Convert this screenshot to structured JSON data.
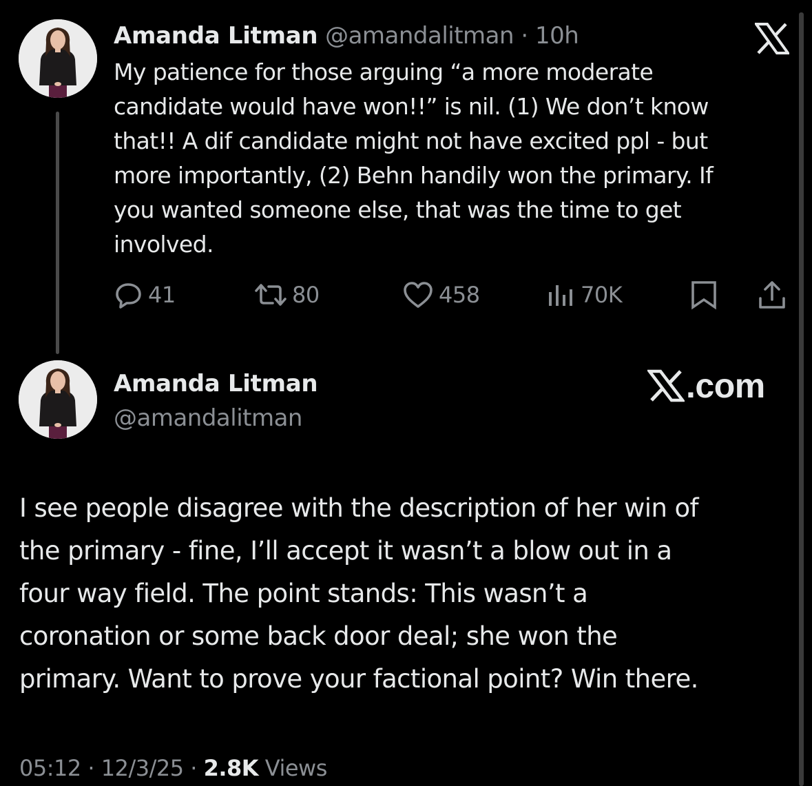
{
  "tweet": {
    "author_name": "Amanda Litman",
    "author_handle": "@amandalitman",
    "time_ago": "10h",
    "separator": " · ",
    "text": "My patience for those arguing “a more moderate\ncandidate would have won!!” is nil. (1) We don’t know\nthat!! A dif candidate might not have excited ppl - but\nmore importantly, (2) Behn handily won the primary. If\nyou wanted someone else, that was the time to get\ninvolved.",
    "actions": {
      "replies": "41",
      "reposts": "80",
      "likes": "458",
      "views": "70K"
    },
    "brand_icon": "x-logo-icon"
  },
  "quote": {
    "author_name": "Amanda Litman",
    "author_handle": "@amandalitman",
    "brand_text": ".com",
    "text": "I see people disagree with the description of her win of\nthe primary - fine, I’ll accept it wasn’t a blow out in a\nfour way field. The point stands: This wasn’t a\ncoronation or some back door deal; she won the\nprimary. Want to prove your factional point? Win there.",
    "time": "05:12",
    "date": "12/3/25",
    "separator": " · ",
    "views_count": "2.8K",
    "views_label": " Views"
  },
  "colors": {
    "background": "#000000",
    "primary_text": "#e7e9ea",
    "secondary_text": "#8b8f94"
  },
  "icons": [
    "reply-icon",
    "repost-icon",
    "like-icon",
    "views-icon",
    "bookmark-icon",
    "share-icon",
    "x-logo-icon"
  ]
}
